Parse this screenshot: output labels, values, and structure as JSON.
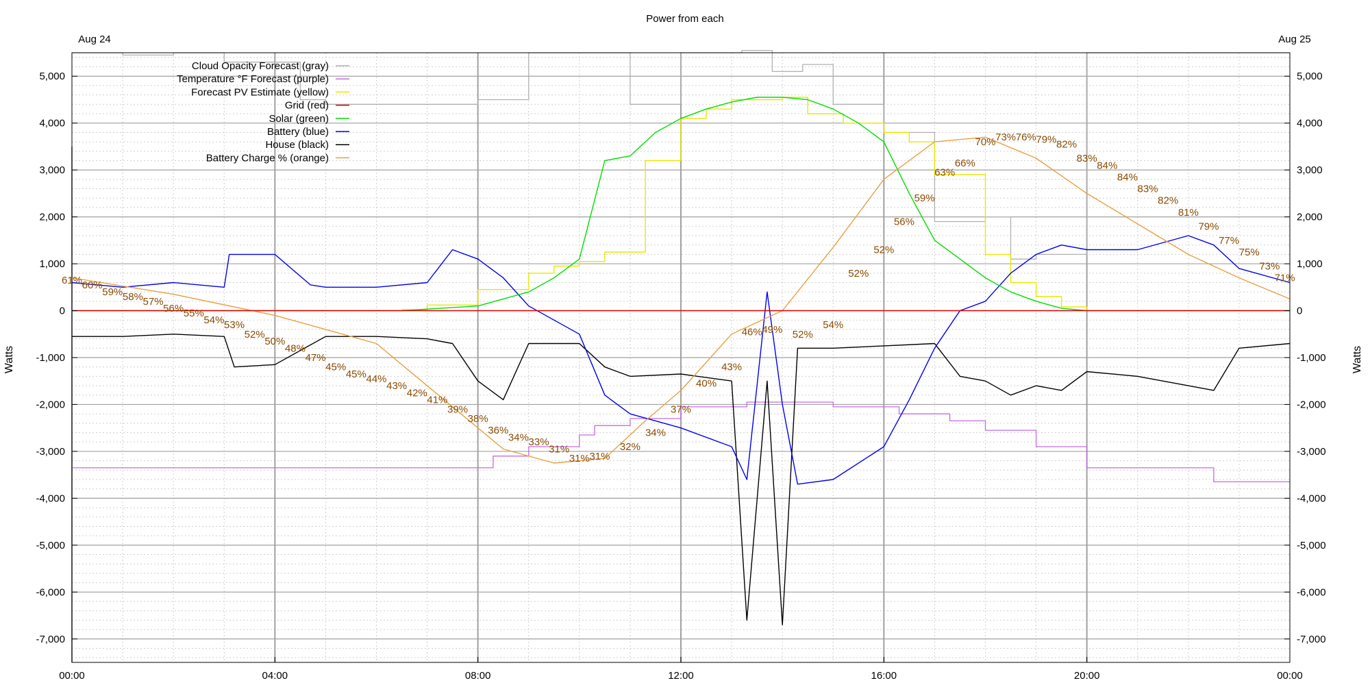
{
  "chart_data": {
    "type": "line",
    "title": "Power from each",
    "date_start": "Aug 24",
    "date_end": "Aug 25",
    "ylabel_left": "Watts",
    "ylabel_right": "Watts",
    "xlim": [
      0,
      24
    ],
    "ylim": [
      -7500,
      5500
    ],
    "x_ticks": [
      0,
      4,
      8,
      12,
      16,
      20,
      24
    ],
    "x_tick_labels": [
      "00:00",
      "04:00",
      "08:00",
      "12:00",
      "16:00",
      "20:00",
      "00:00"
    ],
    "y_ticks": [
      5000,
      4000,
      3000,
      2000,
      1000,
      0,
      -1000,
      -2000,
      -3000,
      -4000,
      -5000,
      -6000,
      -7000
    ],
    "y_tick_labels": [
      "5,000",
      "4,000",
      "3,000",
      "2,000",
      "1,000",
      "0",
      "-1,000",
      "-2,000",
      "-3,000",
      "-4,000",
      "-5,000",
      "-6,000",
      "-7,000"
    ],
    "grid": true,
    "legend_position": "top-left",
    "series": [
      {
        "name": "Cloud Opacity Forecast (gray)",
        "color": "#b0b0b0",
        "step": true,
        "x": [
          0,
          1,
          2,
          3,
          4.5,
          5,
          6,
          7,
          8,
          9,
          11,
          12,
          13.2,
          13.8,
          14.4,
          15,
          16,
          17,
          18,
          18.5,
          19,
          20,
          24
        ],
        "y": [
          5500,
          5450,
          5500,
          5300,
          4500,
          4400,
          4400,
          4400,
          4500,
          5500,
          4400,
          5500,
          5550,
          5100,
          5250,
          4400,
          3800,
          1900,
          2000,
          1100,
          1200,
          5500,
          5500
        ]
      },
      {
        "name": "Temperature °F Forecast (purple)",
        "color": "#c36ce6",
        "step": true,
        "x": [
          0,
          8.3,
          9,
          10,
          10.3,
          11,
          12,
          13.3,
          15,
          16.3,
          17.3,
          18,
          19,
          20,
          21.5,
          22.5,
          24
        ],
        "y": [
          -3350,
          -3100,
          -2900,
          -2650,
          -2450,
          -2300,
          -2050,
          -1950,
          -2050,
          -2200,
          -2350,
          -2550,
          -2900,
          -3350,
          -3350,
          -3650,
          -3650
        ]
      },
      {
        "name": "Forecast PV Estimate (yellow)",
        "color": "#e8e800",
        "step": true,
        "x": [
          6.5,
          7,
          8,
          9,
          9.5,
          10,
          10.5,
          11.3,
          12,
          12.5,
          13,
          14,
          14.5,
          15.2,
          16,
          16.5,
          17,
          18,
          18.5,
          19,
          19.5,
          20
        ],
        "y": [
          20,
          120,
          450,
          800,
          950,
          1050,
          1250,
          3200,
          4100,
          4300,
          4500,
          4550,
          4200,
          4000,
          3800,
          3600,
          2900,
          1200,
          600,
          300,
          80,
          0
        ]
      },
      {
        "name": "Grid (red)",
        "color": "#e00000",
        "step": false,
        "x": [
          0,
          24
        ],
        "y": [
          0,
          0
        ]
      },
      {
        "name": "Solar (green)",
        "color": "#00dd00",
        "step": false,
        "x": [
          0,
          6.5,
          8,
          9,
          9.5,
          10,
          10.5,
          11,
          11.5,
          12,
          12.5,
          13,
          13.5,
          14,
          14.5,
          15,
          15.5,
          16,
          16.5,
          17,
          17.5,
          18,
          18.5,
          19,
          19.5,
          20,
          24
        ],
        "y": [
          0,
          0,
          100,
          400,
          700,
          1100,
          3200,
          3300,
          3800,
          4100,
          4300,
          4450,
          4550,
          4550,
          4500,
          4300,
          4000,
          3600,
          2500,
          1500,
          1100,
          700,
          400,
          200,
          50,
          0,
          0
        ]
      },
      {
        "name": "Battery (blue)",
        "color": "#0000ee",
        "step": false,
        "x": [
          0,
          1,
          2,
          3,
          3.1,
          4,
          4.7,
          5,
          6,
          7,
          7.5,
          8,
          8.5,
          9,
          10,
          10.5,
          11,
          12,
          13,
          13.3,
          13.7,
          14,
          14.3,
          15,
          16,
          16.5,
          17,
          17.5,
          18,
          18.5,
          19,
          19.5,
          20,
          21,
          22,
          22.5,
          23,
          24
        ],
        "y": [
          600,
          500,
          600,
          500,
          1200,
          1200,
          550,
          500,
          500,
          600,
          1300,
          1100,
          700,
          100,
          -500,
          -1800,
          -2200,
          -2500,
          -2900,
          -3600,
          400,
          -2000,
          -3700,
          -3600,
          -2900,
          -1900,
          -800,
          0,
          200,
          800,
          1200,
          1400,
          1300,
          1300,
          1600,
          1400,
          900,
          600
        ]
      },
      {
        "name": "House (black)",
        "color": "#000000",
        "step": false,
        "x": [
          0,
          1,
          2,
          3,
          3.2,
          4,
          5,
          6,
          7,
          7.5,
          8,
          8.5,
          9,
          10,
          10.5,
          11,
          12,
          13,
          13.3,
          13.7,
          14,
          14.3,
          15,
          16,
          17,
          17.5,
          18,
          18.5,
          19,
          19.5,
          20,
          21,
          22,
          22.5,
          23,
          24
        ],
        "y": [
          -550,
          -550,
          -500,
          -550,
          -1200,
          -1150,
          -550,
          -550,
          -600,
          -700,
          -1500,
          -1900,
          -700,
          -700,
          -1200,
          -1400,
          -1350,
          -1500,
          -6600,
          -1500,
          -6700,
          -800,
          -800,
          -750,
          -700,
          -1400,
          -1500,
          -1800,
          -1600,
          -1700,
          -1300,
          -1400,
          -1600,
          -1700,
          -800,
          -700
        ]
      },
      {
        "name": "Battery Charge % (orange)",
        "color": "#e8a040",
        "step": false,
        "x": [
          0,
          2,
          4,
          6,
          8.5,
          9.5,
          10.5,
          11.3,
          12,
          13,
          14,
          15,
          16,
          17,
          18,
          19,
          20,
          21,
          22,
          23,
          24
        ],
        "y": [
          700,
          350,
          -100,
          -700,
          -2950,
          -3250,
          -3150,
          -2350,
          -1700,
          -500,
          0,
          1350,
          2800,
          3600,
          3700,
          3250,
          2500,
          1850,
          1200,
          700,
          250
        ]
      }
    ],
    "percent_labels": {
      "x": [
        0,
        0.4,
        0.8,
        1.2,
        1.6,
        2,
        2.4,
        2.8,
        3.2,
        3.6,
        4,
        4.4,
        4.8,
        5.2,
        5.6,
        6,
        6.4,
        6.8,
        7.2,
        7.6,
        8,
        8.4,
        8.8,
        9.2,
        9.6,
        10,
        10.4,
        11,
        11.5,
        12,
        12.5,
        13,
        13.4,
        13.8,
        14.4,
        15,
        15.5,
        16,
        16.4,
        16.8,
        17.2,
        17.6,
        18,
        18.4,
        18.8,
        19.2,
        19.6,
        20,
        20.4,
        20.8,
        21.2,
        21.6,
        22,
        22.4,
        22.8,
        23.2,
        23.6,
        23.9
      ],
      "y": [
        650,
        550,
        400,
        300,
        200,
        50,
        -50,
        -200,
        -300,
        -500,
        -650,
        -800,
        -1000,
        -1200,
        -1350,
        -1450,
        -1600,
        -1750,
        -1900,
        -2100,
        -2300,
        -2550,
        -2700,
        -2800,
        -2950,
        -3150,
        -3100,
        -2900,
        -2600,
        -2100,
        -1550,
        -1200,
        -450,
        -400,
        -500,
        -300,
        800,
        1300,
        1900,
        2400,
        2950,
        3150,
        3600,
        3700,
        3700,
        3650,
        3550,
        3250,
        3100,
        2850,
        2600,
        2350,
        2100,
        1800,
        1500,
        1250,
        950,
        700
      ],
      "labels": [
        "61%",
        "60%",
        "59%",
        "58%",
        "57%",
        "56%",
        "55%",
        "54%",
        "53%",
        "52%",
        "50%",
        "48%",
        "47%",
        "45%",
        "45%",
        "44%",
        "43%",
        "42%",
        "41%",
        "39%",
        "38%",
        "36%",
        "34%",
        "33%",
        "31%",
        "31%",
        "31%",
        "32%",
        "34%",
        "37%",
        "40%",
        "43%",
        "46%",
        "49%",
        "52%",
        "54%",
        "52%",
        "52%",
        "56%",
        "59%",
        "63%",
        "66%",
        "70%",
        "73%",
        "76%",
        "79%",
        "82%",
        "83%",
        "84%",
        "84%",
        "83%",
        "82%",
        "81%",
        "79%",
        "77%",
        "75%",
        "73%",
        "71%"
      ]
    }
  }
}
